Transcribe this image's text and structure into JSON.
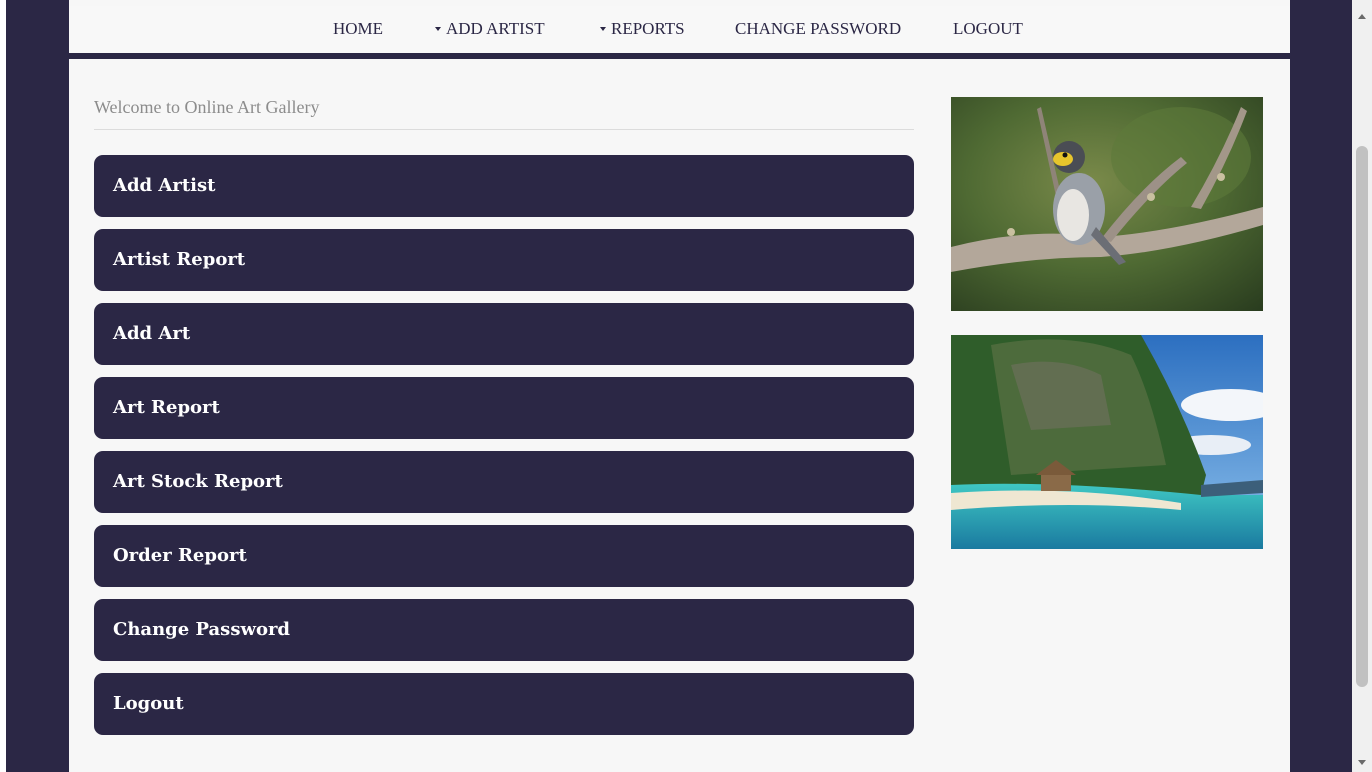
{
  "nav": {
    "home": "HOME",
    "add_artist": "ADD ARTIST",
    "reports": "REPORTS",
    "change_password": "CHANGE PASSWORD",
    "logout": "LOGOUT"
  },
  "welcome": "Welcome to Online Art Gallery",
  "menu": [
    "Add Artist",
    "Artist Report",
    "Add Art",
    "Art Report",
    "Art Stock Report",
    "Order Report",
    "Change Password",
    "Logout"
  ],
  "images": [
    "bird-photo",
    "beach-photo"
  ],
  "colors": {
    "primary": "#2b2745",
    "background": "#f7f7f7",
    "muted_text": "#8c8c8c"
  }
}
